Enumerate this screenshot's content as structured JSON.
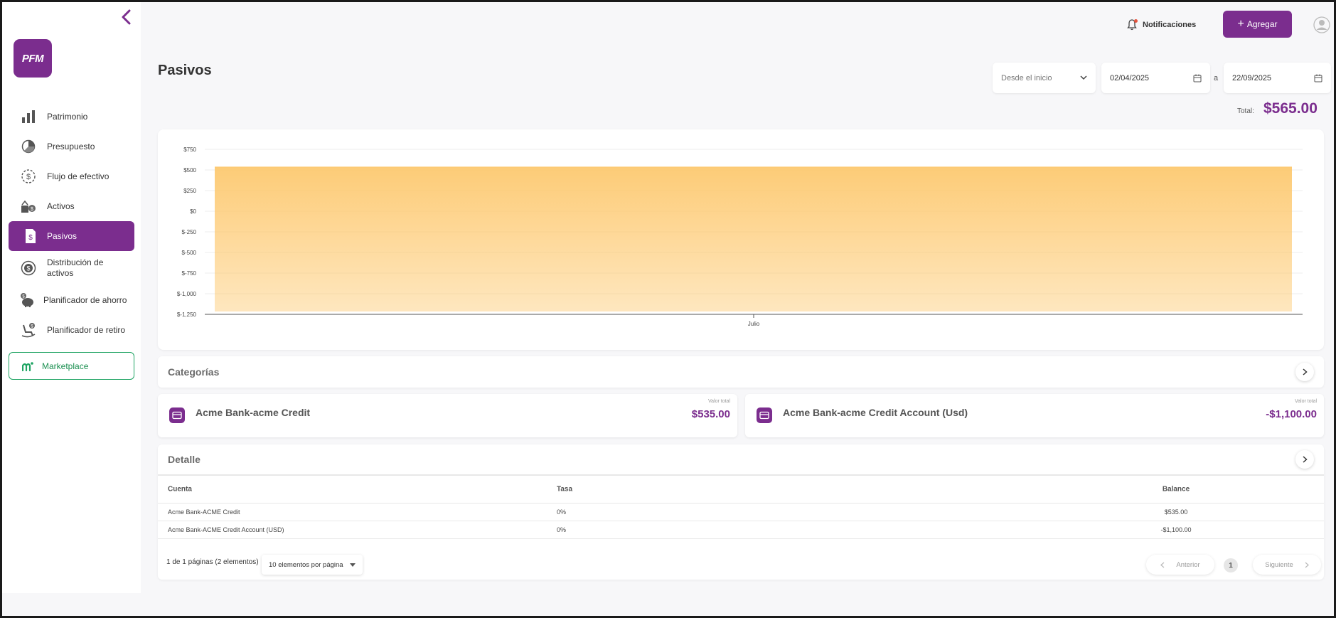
{
  "app": {
    "logo_text": "PFM",
    "brand_color": "#7b2d8e",
    "accent_green": "#1fa463"
  },
  "sidebar": {
    "items": [
      {
        "label": "Patrimonio",
        "icon": "bar-chart-icon"
      },
      {
        "label": "Presupuesto",
        "icon": "pie-chart-icon"
      },
      {
        "label": "Flujo de efectivo",
        "icon": "cash-flow-icon"
      },
      {
        "label": "Activos",
        "icon": "assets-icon"
      },
      {
        "label": "Pasivos",
        "icon": "liabilities-document-icon",
        "active": true
      },
      {
        "label": "Distribución de activos",
        "icon": "coin-distribution-icon"
      },
      {
        "label": "Planificador de ahorro",
        "icon": "piggy-bank-icon"
      },
      {
        "label": "Planificador de retiro",
        "icon": "rocking-chair-icon"
      }
    ],
    "marketplace_label": "Marketplace"
  },
  "topbar": {
    "notifications_label": "Notificaciones",
    "add_label": "Agregar"
  },
  "page": {
    "title": "Pasivos",
    "period_select": "Desde el inicio",
    "date_from": "02/04/2025",
    "date_separator": "a",
    "date_to": "22/09/2025",
    "total_label": "Total:",
    "total_value": "$565.00"
  },
  "chart_data": {
    "type": "area",
    "x": [
      "Julio"
    ],
    "series": [
      {
        "values": [
          535
        ]
      }
    ],
    "ylim": [
      -1250,
      750
    ],
    "yticks": [
      "$750",
      "$500",
      "$250",
      "$0",
      "$-250",
      "$-500",
      "$-750",
      "$-1,000",
      "$-1,250"
    ],
    "grid": true,
    "fill_color": "#fdc970"
  },
  "categories": {
    "title": "Categorías",
    "items": [
      {
        "name": "Acme Bank-acme Credit",
        "value_label": "Valor total",
        "value": "$535.00"
      },
      {
        "name": "Acme Bank-acme Credit Account (Usd)",
        "value_label": "Valor total",
        "value": "-$1,100.00"
      }
    ]
  },
  "detail": {
    "title": "Detalle",
    "columns": [
      "Cuenta",
      "Tasa",
      "Balance"
    ],
    "rows": [
      [
        "Acme Bank-ACME Credit",
        "0%",
        "$535.00"
      ],
      [
        "Acme Bank-ACME Credit Account (USD)",
        "0%",
        "-$1,100.00"
      ]
    ],
    "pager_info": "1 de 1 páginas (2 elementos)",
    "per_page": "10 elementos por página",
    "prev_label": "Anterior",
    "page_number": "1",
    "next_label": "Siguiente"
  }
}
